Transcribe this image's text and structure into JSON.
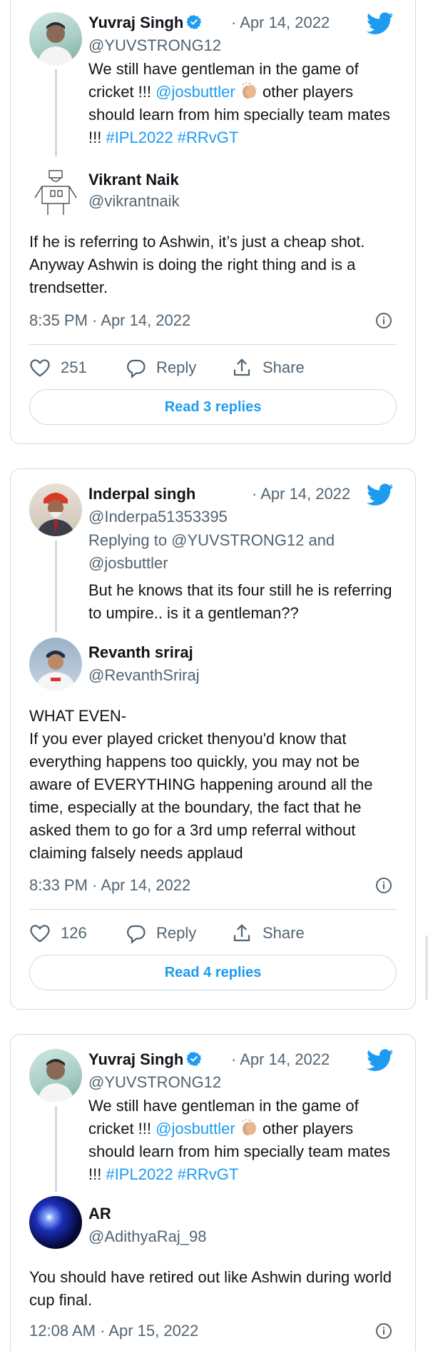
{
  "colors": {
    "link": "#1d9bf0",
    "muted": "#536471",
    "text": "#0f1419",
    "border": "#cfd9de"
  },
  "cards": [
    {
      "parent": {
        "name": "Yuvraj Singh",
        "verified": true,
        "date": "· Apr 14, 2022",
        "handle": "@YUVSTRONG12",
        "text_1": "We still have gentleman in the game of cricket !!! ",
        "mention": "@josbuttler",
        "emoji_icon": "clapping-hands-icon",
        "text_2": " other players should learn from him specially team mates !!! ",
        "hashtag_1": "#IPL2022",
        "hashtag_2": "#RRvGT"
      },
      "reply": {
        "name": "Vikrant Naik",
        "handle": "@vikrantnaik",
        "text": "If he is referring to Ashwin, it’s just a cheap shot. Anyway Ashwin is doing the right thing and is a trendsetter.",
        "timestamp": "8:35 PM · Apr 14, 2022"
      },
      "likes": "251",
      "reply_label": "Reply",
      "share_label": "Share",
      "read_replies": "Read 3 replies"
    },
    {
      "parent": {
        "name": "Inderpal singh",
        "date": "· Apr 14, 2022",
        "handle": "@Inderpa51353395",
        "replying_to": "Replying to @YUVSTRONG12 and @josbuttler",
        "text": "But he knows that its four still he is referring to umpire.. is it a gentleman??"
      },
      "reply": {
        "name": "Revanth sriraj",
        "handle": "@RevanthSriraj",
        "text_line1": "WHAT EVEN-",
        "text": "If you ever played cricket thenyou'd know that everything happens too quickly, you may not be aware of EVERYTHING happening around all the time, especially at the boundary, the fact that he asked them to go for a 3rd ump referral without claiming falsely needs applaud",
        "timestamp": "8:33 PM · Apr 14, 2022"
      },
      "likes": "126",
      "reply_label": "Reply",
      "share_label": "Share",
      "read_replies": "Read 4 replies"
    },
    {
      "parent": {
        "name": "Yuvraj Singh",
        "verified": true,
        "date": "· Apr 14, 2022",
        "handle": "@YUVSTRONG12",
        "text_1": "We still have gentleman in the game of cricket !!! ",
        "mention": "@josbuttler",
        "emoji_icon": "clapping-hands-icon",
        "text_2": " other players should learn from him specially team mates !!! ",
        "hashtag_1": "#IPL2022",
        "hashtag_2": "#RRvGT"
      },
      "reply": {
        "name": "AR",
        "handle": "@AdithyaRaj_98",
        "text": "You should have retired out like Ashwin during world cup final.",
        "timestamp": "12:08 AM · Apr 15, 2022"
      }
    }
  ]
}
